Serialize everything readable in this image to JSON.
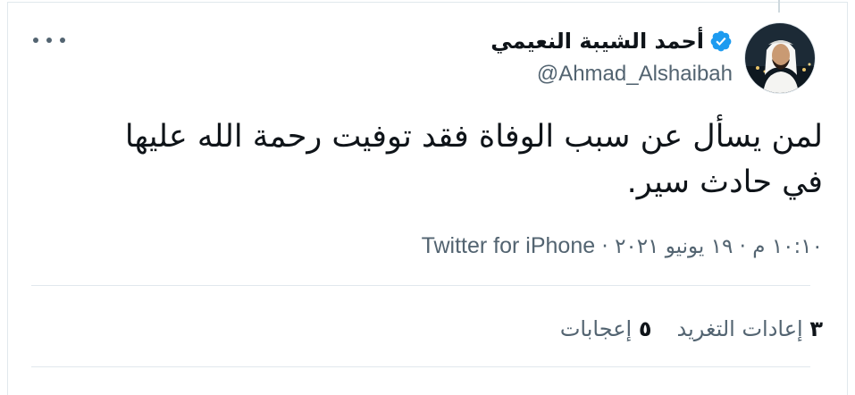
{
  "tweet": {
    "author": {
      "display_name": "أحمد الشيبة النعيمي",
      "handle": "@Ahmad_Alshaibah",
      "verified": true
    },
    "text_line_1": "لمن يسأل عن سبب الوفاة فقد توفيت رحمة الله عليها",
    "text_line_2": "في حادث سير.",
    "timestamp": "١٠:١٠ م · ١٩ يونيو ٢٠٢١",
    "separator": " · ",
    "source": "Twitter for iPhone",
    "retweets": {
      "count": "٣",
      "label": "إعادات التغريد"
    },
    "likes": {
      "count": "٥",
      "label": "إعجابات"
    }
  },
  "icons": {
    "verified": "verified-badge-icon",
    "more": "more-options-icon",
    "avatar": "profile-photo"
  },
  "colors": {
    "verified_blue": "#1d9bf0",
    "text_primary": "#0f1419",
    "text_secondary": "#536471",
    "border": "#e1e8ed"
  }
}
